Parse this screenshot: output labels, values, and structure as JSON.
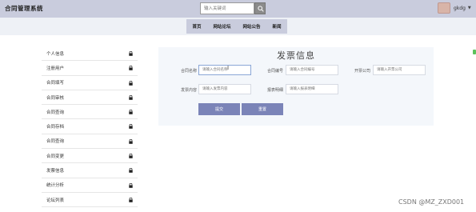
{
  "header": {
    "brand": "合同管理系统",
    "search_placeholder": "输入关键词",
    "username": "gkdg",
    "user_caret": "▼"
  },
  "nav": {
    "items": [
      "首页",
      "网站论坛",
      "网站公告",
      "新闻"
    ]
  },
  "sidebar": {
    "items": [
      "个人信息",
      "注册用户",
      "合同填写",
      "合同审核",
      "合同查询",
      "合同存档",
      "合同查询",
      "合同变更",
      "发票信息",
      "统计分析",
      "论坛列表"
    ]
  },
  "form": {
    "title": "发票信息",
    "fields": [
      {
        "label": "合同名称",
        "placeholder": "请输入合同名称"
      },
      {
        "label": "合同编号",
        "placeholder": "请输入合同编号"
      },
      {
        "label": "开票公司",
        "placeholder": "请输入开票公司"
      },
      {
        "label": "发票内容",
        "placeholder": "请输入发票内容"
      },
      {
        "label": "报表明细",
        "placeholder": "请输入报表明细"
      }
    ],
    "submit_label": "提交",
    "reset_label": "重置"
  },
  "watermark": "CSDN @MZ_ZXD001",
  "colors": {
    "topbar": "#c9ccdd",
    "button": "#7b84b8",
    "panel": "#f4f7fb"
  }
}
